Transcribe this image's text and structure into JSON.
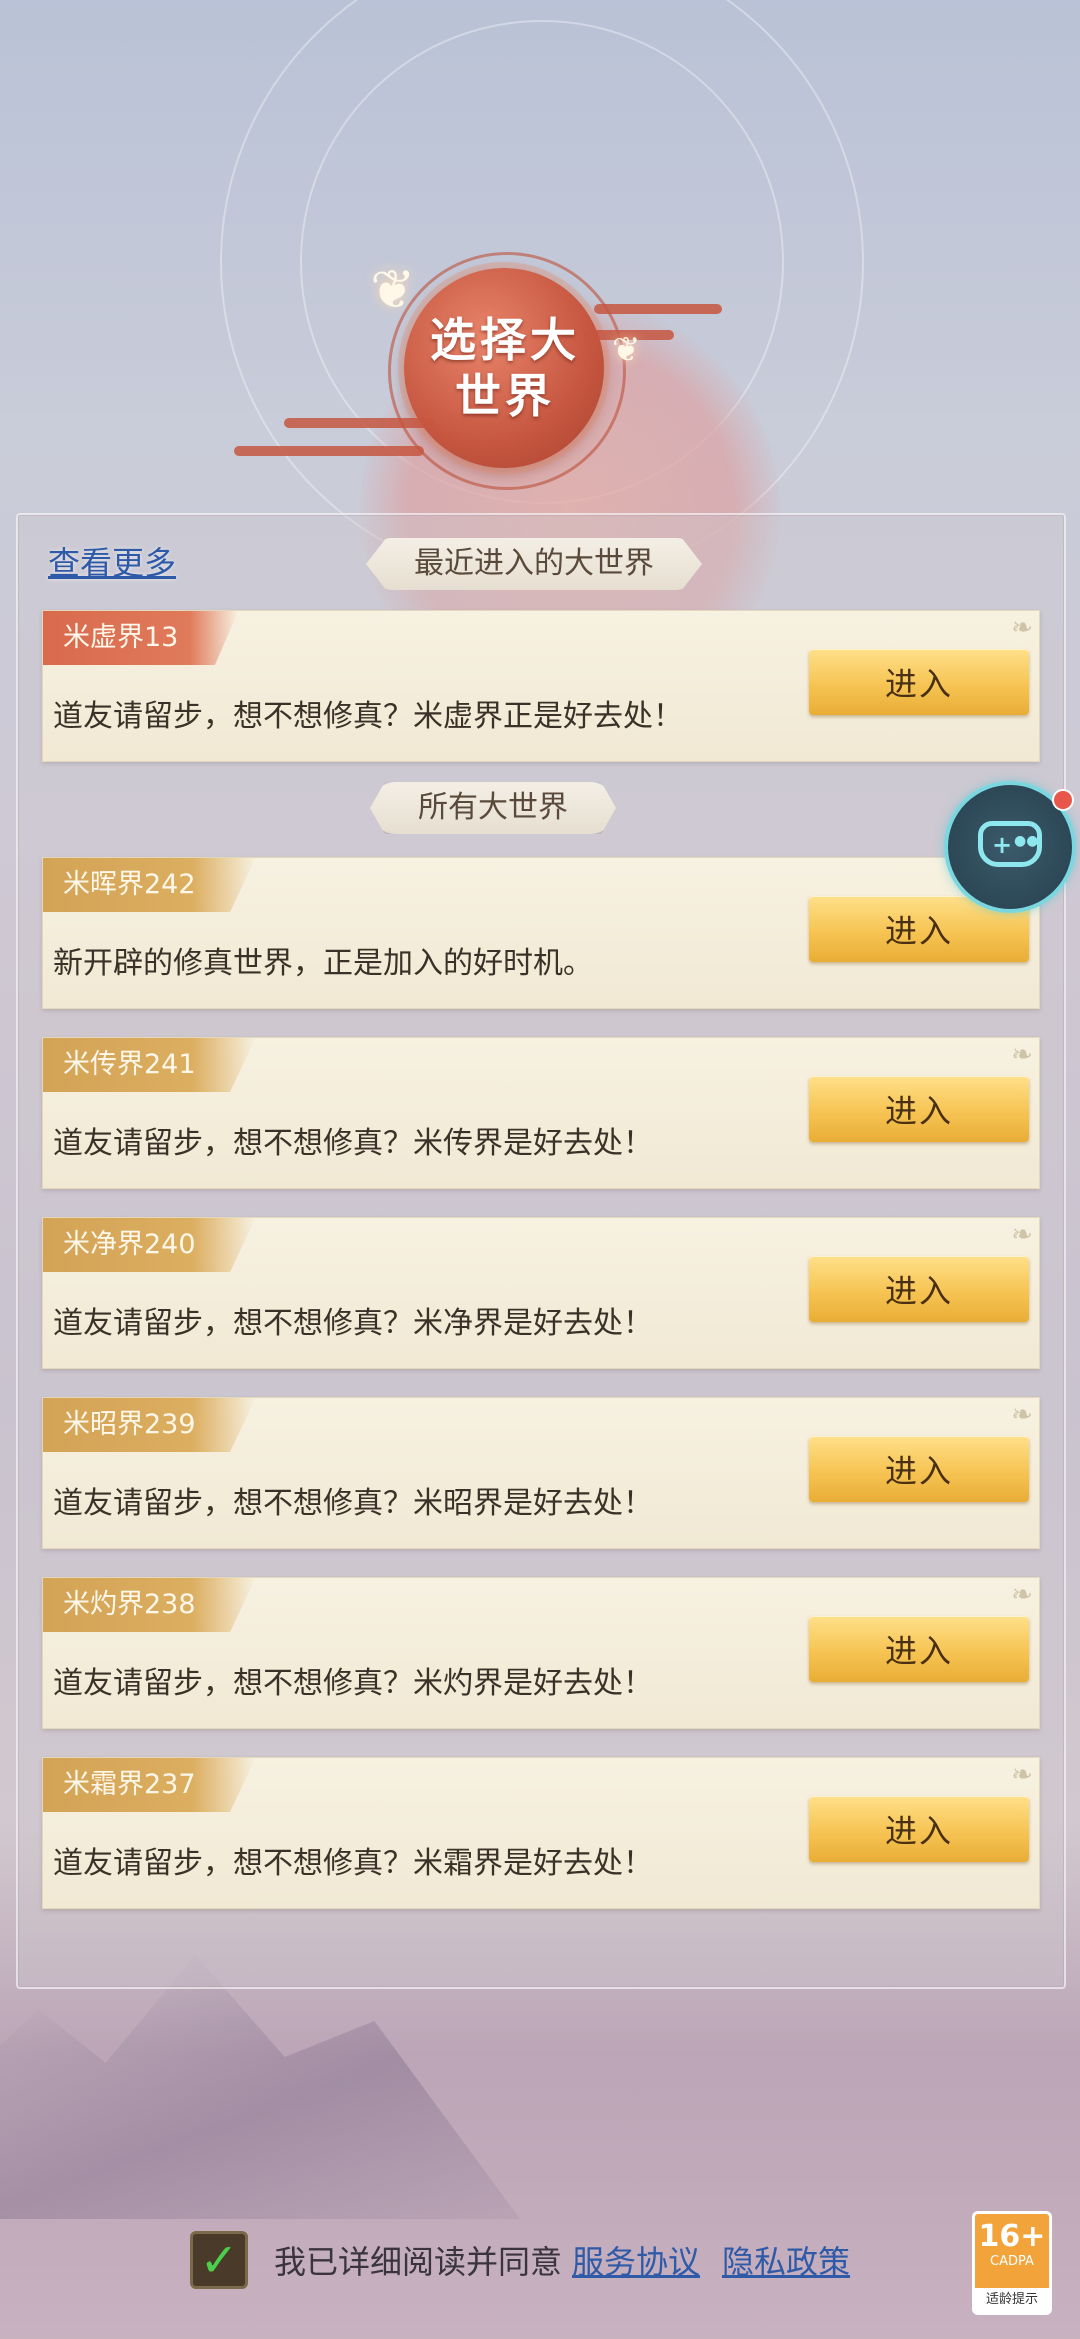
{
  "header": {
    "title": "选择大世界"
  },
  "recent": {
    "more_link": "查看更多",
    "title": "最近进入的大世界",
    "worlds": [
      {
        "name": "米虚界13",
        "desc": "道友请留步，想不想修真？米虚界正是好去处！",
        "button": "进入"
      }
    ]
  },
  "all": {
    "title": "所有大世界",
    "worlds": [
      {
        "name": "米晖界242",
        "desc": "新开辟的修真世界，正是加入的好时机。",
        "button": "进入"
      },
      {
        "name": "米传界241",
        "desc": "道友请留步，想不想修真？米传界是好去处！",
        "button": "进入"
      },
      {
        "name": "米净界240",
        "desc": "道友请留步，想不想修真？米净界是好去处！",
        "button": "进入"
      },
      {
        "name": "米昭界239",
        "desc": "道友请留步，想不想修真？米昭界是好去处！",
        "button": "进入"
      },
      {
        "name": "米灼界238",
        "desc": "道友请留步，想不想修真？米灼界是好去处！",
        "button": "进入"
      },
      {
        "name": "米霜界237",
        "desc": "道友请留步，想不想修真？米霜界是好去处！",
        "button": "进入"
      }
    ]
  },
  "agreement": {
    "checked": true,
    "text": "我已详细阅读并同意",
    "service_link": "服务协议",
    "privacy_link": "隐私政策"
  },
  "age_rating": {
    "age": "16+",
    "org": "CADPA",
    "caption": "适龄提示"
  },
  "floating": {
    "icon": "gamepad-icon",
    "has_notification": true
  }
}
